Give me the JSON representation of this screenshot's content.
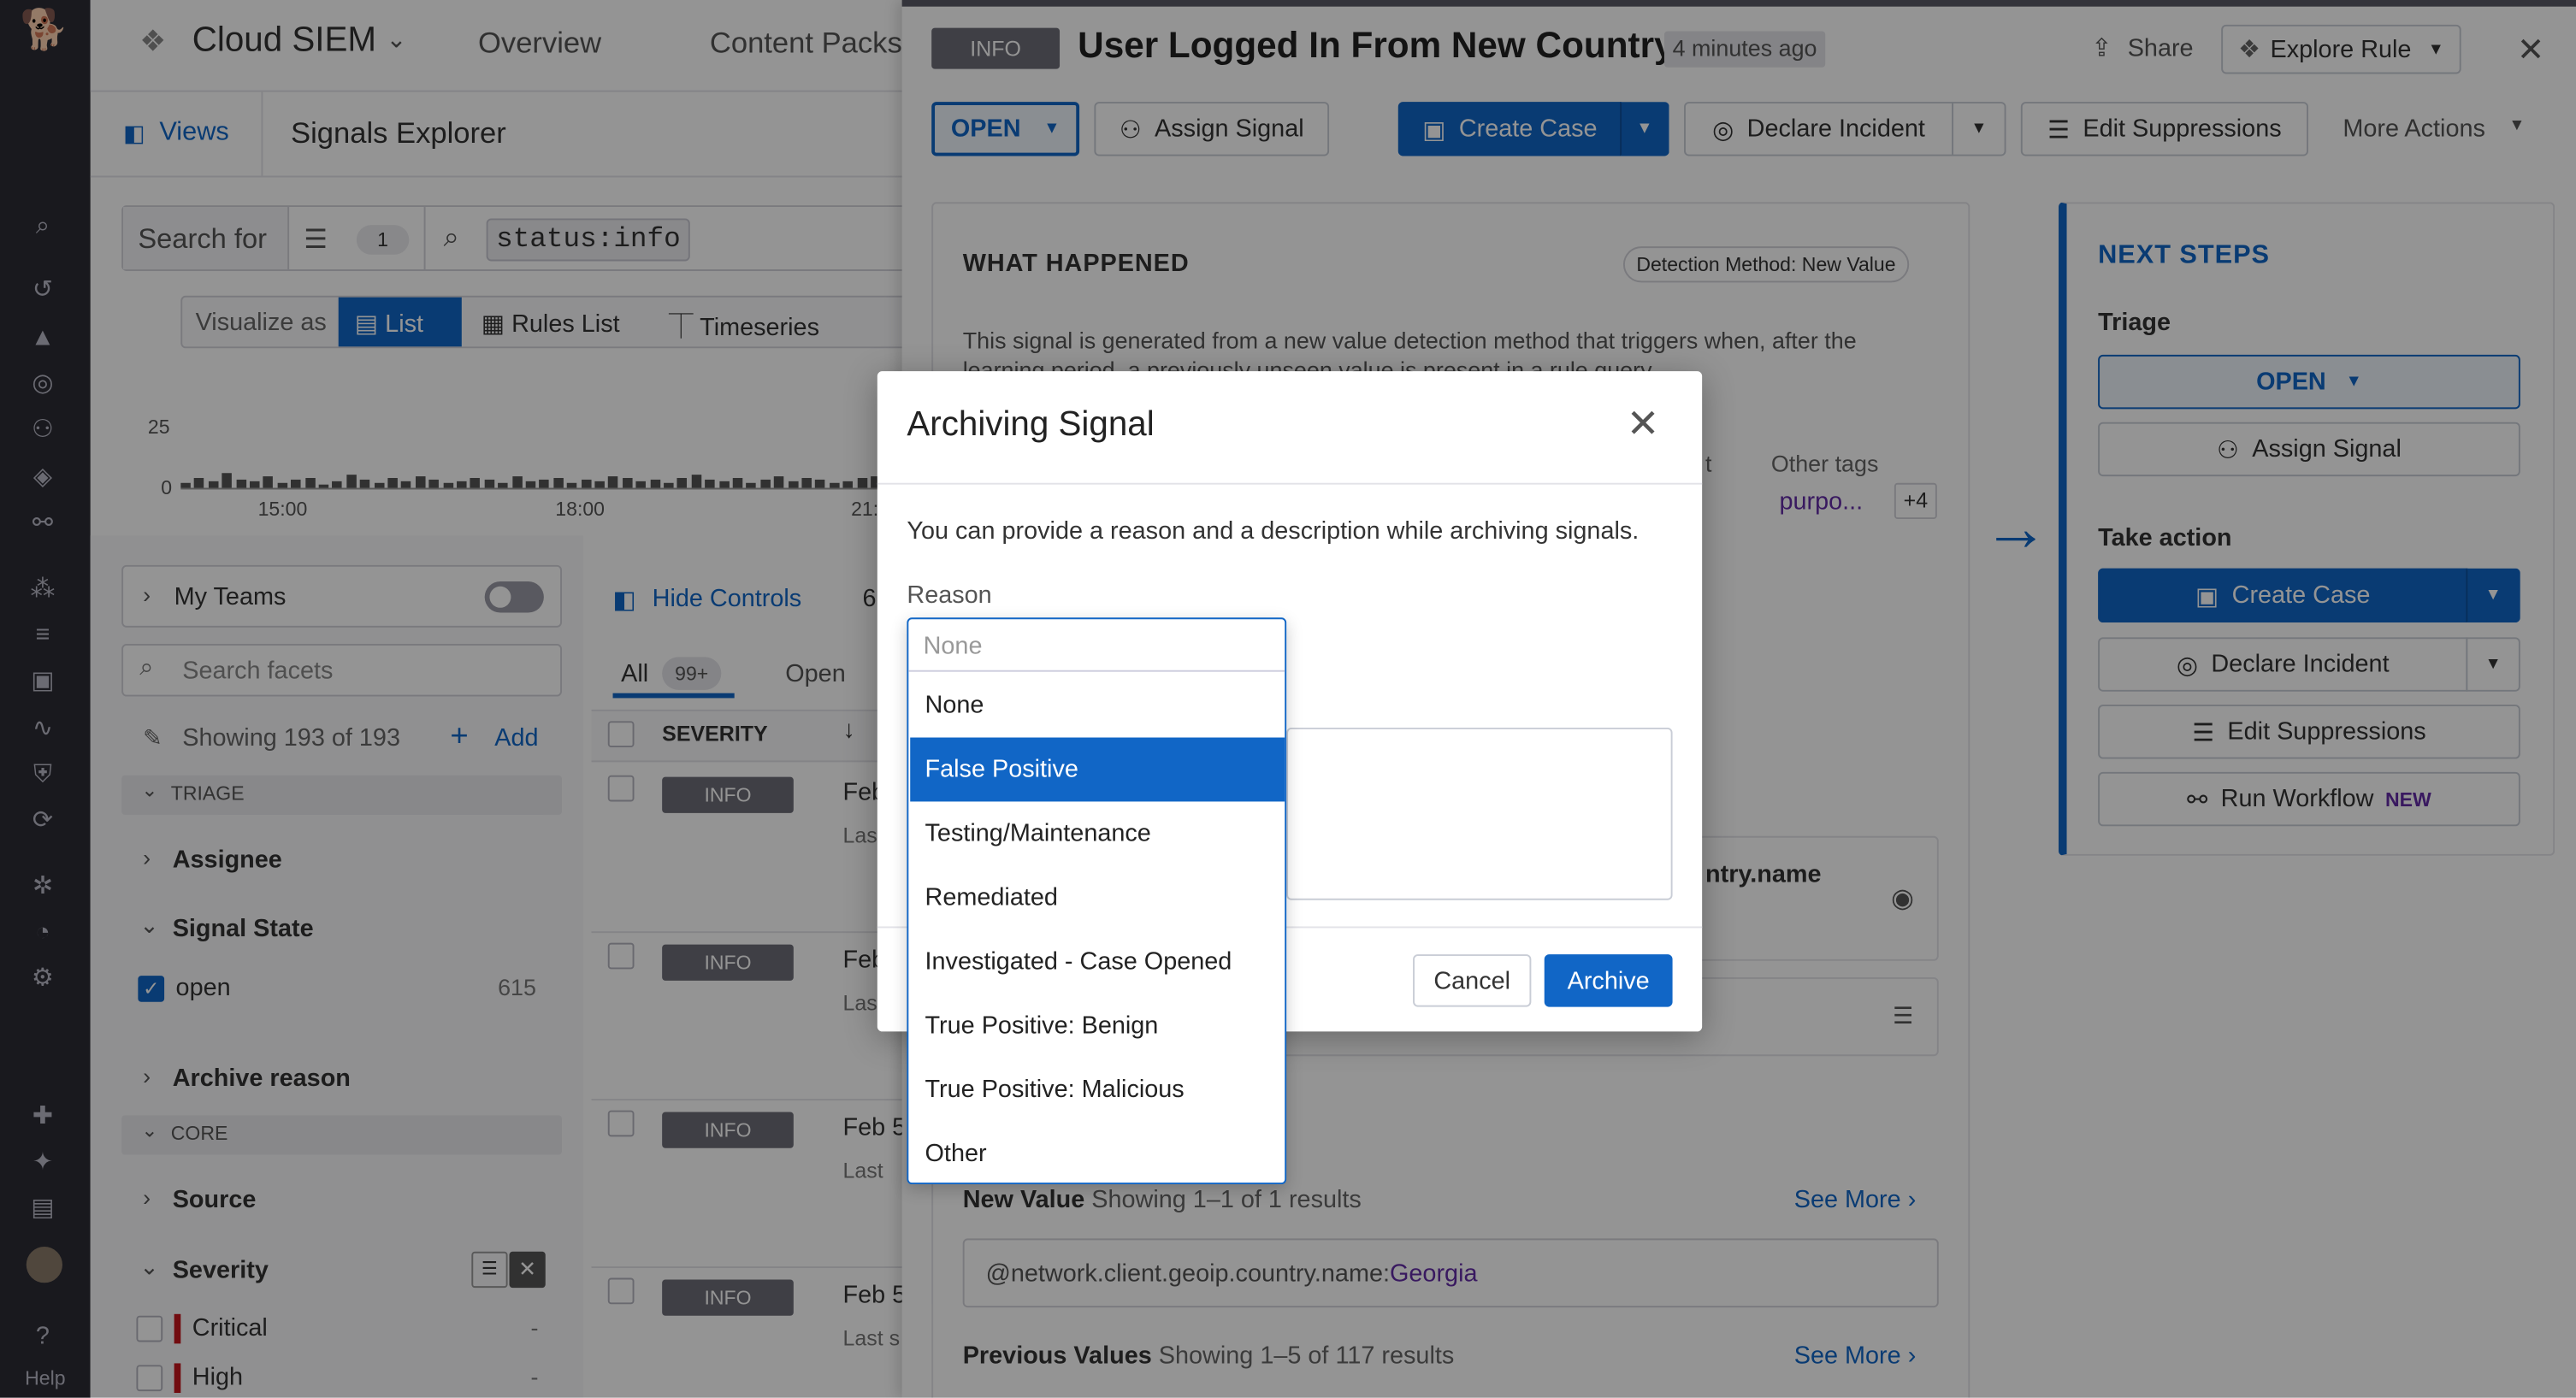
{
  "app": {
    "product": "Cloud SIEM",
    "nav_tabs": [
      "Overview",
      "Content Packs"
    ],
    "help": "Help"
  },
  "explorer": {
    "views": "Views",
    "title": "Signals Explorer",
    "search_for": "Search for",
    "filter_count": "1",
    "query": "status:info",
    "visualize_as": "Visualize as",
    "viz_tabs": [
      "List",
      "Rules List",
      "Timeseries"
    ],
    "y_ticks": [
      "25",
      "0"
    ],
    "x_ticks": [
      "15:00",
      "18:00",
      "21:"
    ],
    "hide_controls": "Hide Controls",
    "tabs": {
      "all": "All",
      "all_count": "99+",
      "open": "Open"
    },
    "col_severity": "SEVERITY",
    "rows": [
      {
        "sev": "INFO",
        "date": "Feb",
        "sub": "Las"
      },
      {
        "sev": "INFO",
        "date": "Feb",
        "sub": "Las"
      },
      {
        "sev": "INFO",
        "date": "Feb 5",
        "sub": "Last"
      },
      {
        "sev": "INFO",
        "date": "Feb 5",
        "sub": "Last s"
      }
    ]
  },
  "facets": {
    "my_teams": "My Teams",
    "search_placeholder": "Search facets",
    "showing": "Showing 193 of 193",
    "add": "Add",
    "triage": "TRIAGE",
    "assignee": "Assignee",
    "signal_state": "Signal State",
    "open": "open",
    "open_count": "615",
    "archive_reason": "Archive reason",
    "core": "CORE",
    "source": "Source",
    "severity": "Severity",
    "critical": "Critical",
    "high": "High",
    "dash": "-"
  },
  "signal": {
    "badge": "INFO",
    "title": "User Logged In From New Country",
    "age": "4 minutes ago",
    "share": "Share",
    "explore_rule": "Explore Rule",
    "status": "OPEN",
    "assign": "Assign Signal",
    "create_case": "Create Case",
    "declare": "Declare Incident",
    "edit_supp": "Edit Suppressions",
    "more": "More Actions",
    "what_happened": "WHAT HAPPENED",
    "detection": "Detection Method: New Value",
    "desc": "This signal is generated from a new value detection method that triggers when, after the learning period, a previously unseen value is present in a rule query",
    "other_tags": "Other tags",
    "tag_val": "purpo...",
    "tag_more": "+4",
    "t_frag": "t",
    "country_frag": "ntry.name",
    "new_value_label": "New Value",
    "new_value_showing": "Showing 1–1 of 1 results",
    "see_more": "See More",
    "query_key": "@network.client.geoip.country.name:",
    "query_val": "Georgia",
    "prev_label": "Previous Values",
    "prev_showing": "Showing 1–5 of 117 results"
  },
  "next_steps": {
    "title": "NEXT STEPS",
    "triage": "Triage",
    "status": "OPEN",
    "assign": "Assign Signal",
    "take_action": "Take action",
    "create_case": "Create Case",
    "declare": "Declare Incident",
    "edit_supp": "Edit Suppressions",
    "workflow": "Run Workflow",
    "new": "NEW"
  },
  "modal": {
    "title": "Archiving Signal",
    "text": "You can provide a reason and a description while archiving signals.",
    "reason_label": "Reason",
    "placeholder": "None",
    "options": [
      "None",
      "False Positive",
      "Testing/Maintenance",
      "Remediated",
      "Investigated - Case Opened",
      "True Positive: Benign",
      "True Positive: Malicious",
      "Other"
    ],
    "selected_index": 1,
    "cancel": "Cancel",
    "archive": "Archive"
  },
  "colors": {
    "accent": "#1166c6",
    "nav_bg": "#2c2c35",
    "purple": "#632ca6"
  }
}
